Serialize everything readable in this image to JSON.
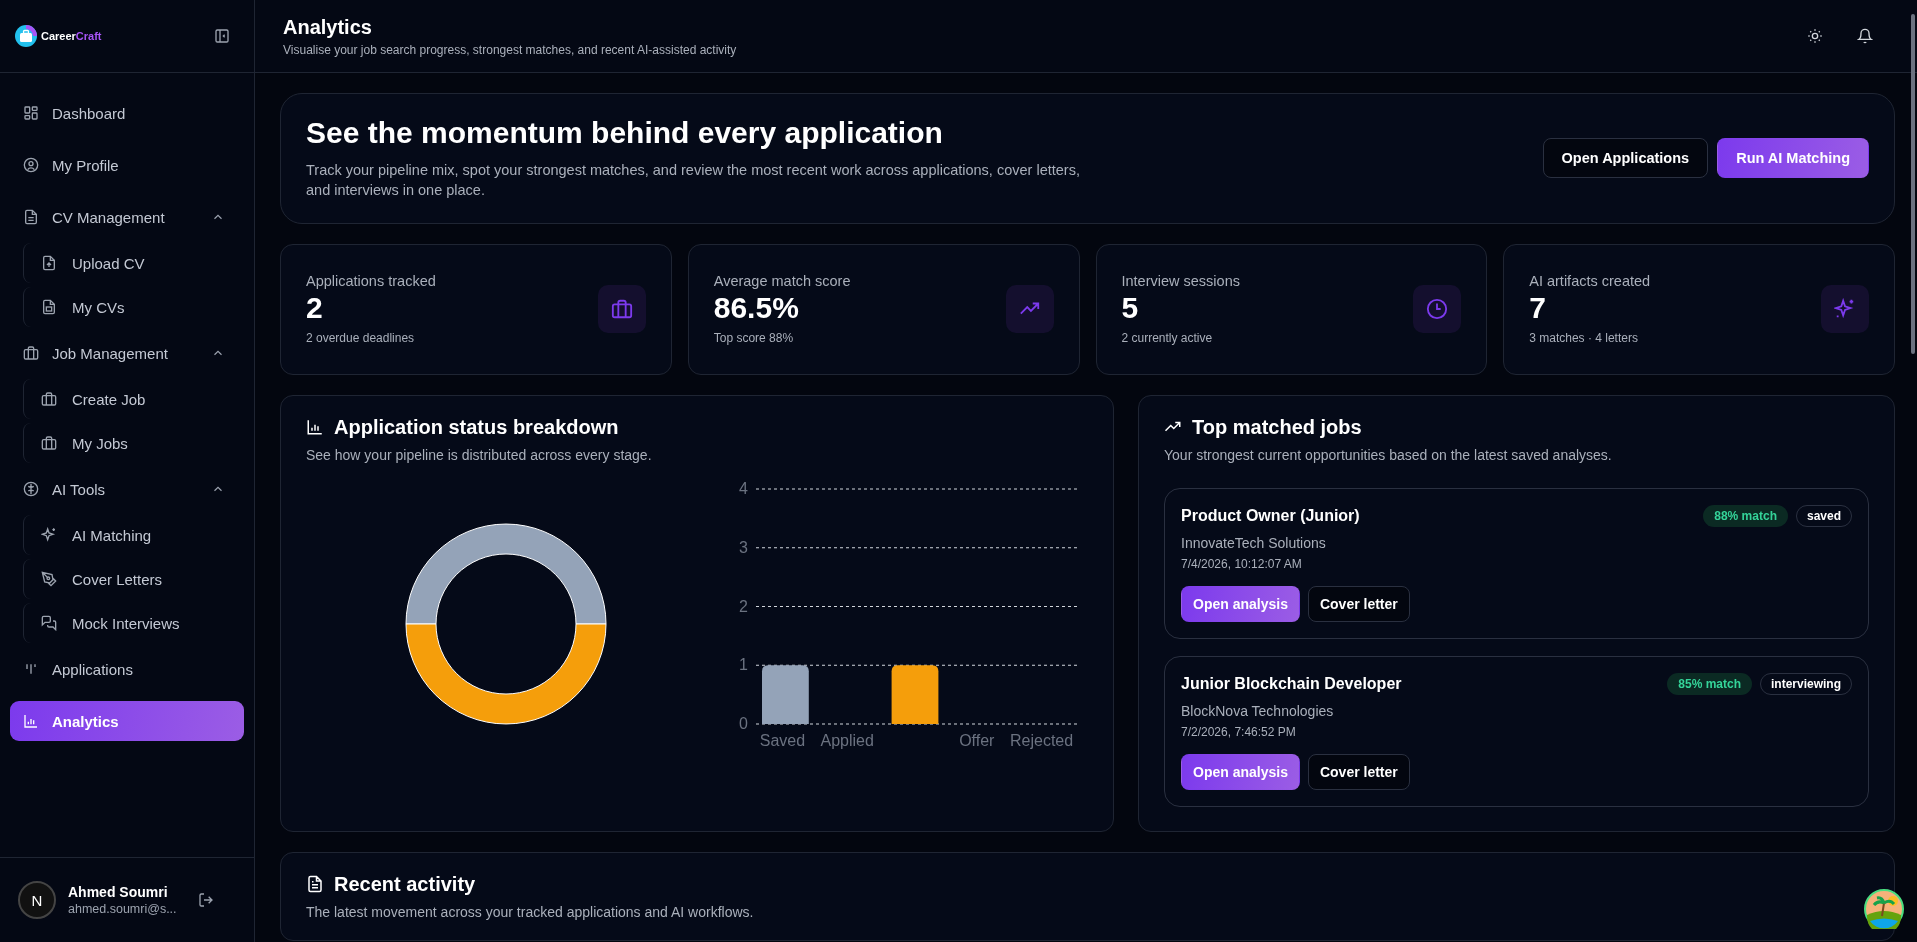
{
  "sidebar": {
    "logo": {
      "word": "Career",
      "accent": "Craft"
    },
    "items": [
      {
        "label": "Dashboard",
        "selected": false
      },
      {
        "label": "My Profile",
        "selected": false
      },
      {
        "label": "CV Management",
        "expanded": true,
        "children": [
          {
            "label": "Upload CV",
            "selected": false
          },
          {
            "label": "My CVs",
            "selected": false
          }
        ]
      },
      {
        "label": "Job Management",
        "expanded": true,
        "children": [
          {
            "label": "Create Job",
            "selected": false
          },
          {
            "label": "My Jobs",
            "selected": false
          }
        ]
      },
      {
        "label": "AI Tools",
        "expanded": true,
        "children": [
          {
            "label": "AI Matching",
            "selected": false
          },
          {
            "label": "Cover Letters",
            "selected": false
          },
          {
            "label": "Mock Interviews",
            "selected": false
          }
        ]
      },
      {
        "label": "Applications",
        "selected": false
      },
      {
        "label": "Analytics",
        "selected": true
      }
    ],
    "user": {
      "avatar_letter": "N",
      "name": "Ahmed Soumri",
      "email": "ahmed.soumri@s..."
    }
  },
  "header": {
    "title": "Analytics",
    "subtitle": "Visualise your job search progress, strongest matches, and recent AI-assisted activity"
  },
  "hero": {
    "title": "See the momentum behind every application",
    "text": "Track your pipeline mix, spot your strongest matches, and review the most recent work across applications, cover letters, and interviews in one place.",
    "buttons": [
      {
        "label": "Open Applications",
        "kind": "outline"
      },
      {
        "label": "Run AI Matching",
        "kind": "primary"
      }
    ]
  },
  "stats": [
    {
      "label": "Applications tracked",
      "value": "2",
      "note": "2 overdue deadlines"
    },
    {
      "label": "Average match score",
      "value": "86.5%",
      "note": "Top score 88%"
    },
    {
      "label": "Interview sessions",
      "value": "5",
      "note": "2 currently active"
    },
    {
      "label": "AI artifacts created",
      "value": "7",
      "note": "3 matches · 4 letters"
    }
  ],
  "status_breakdown": {
    "title": "Application status breakdown",
    "subtitle": "See how your pipeline is distributed across every stage.",
    "chart_data": {
      "type": "bar",
      "categories": [
        "Saved",
        "Applied",
        null,
        "Offer",
        "Rejected"
      ],
      "values": [
        1,
        0,
        1,
        0,
        0
      ],
      "colors": [
        "#94a3b8",
        null,
        "#f59e0b",
        null,
        null
      ],
      "ylim": [
        0,
        4
      ],
      "yticks": [
        0,
        1,
        2,
        3,
        4
      ],
      "grid": true
    }
  },
  "top_jobs": {
    "title": "Top matched jobs",
    "subtitle": "Your strongest current opportunities based on the latest saved analyses.",
    "jobs": [
      {
        "title": "Product Owner (Junior)",
        "company": "InnovateTech Solutions",
        "date": "7/4/2026, 10:12:07 AM",
        "match": "88% match",
        "status": "saved",
        "buttons": [
          "Open analysis",
          "Cover letter"
        ]
      },
      {
        "title": "Junior Blockchain Developer",
        "company": "BlockNova Technologies",
        "date": "7/2/2026, 7:46:52 PM",
        "match": "85% match",
        "status": "interviewing",
        "buttons": [
          "Open analysis",
          "Cover letter"
        ]
      }
    ]
  },
  "recent_activity": {
    "title": "Recent activity",
    "subtitle": "The latest movement across your tracked applications and AI workflows."
  }
}
